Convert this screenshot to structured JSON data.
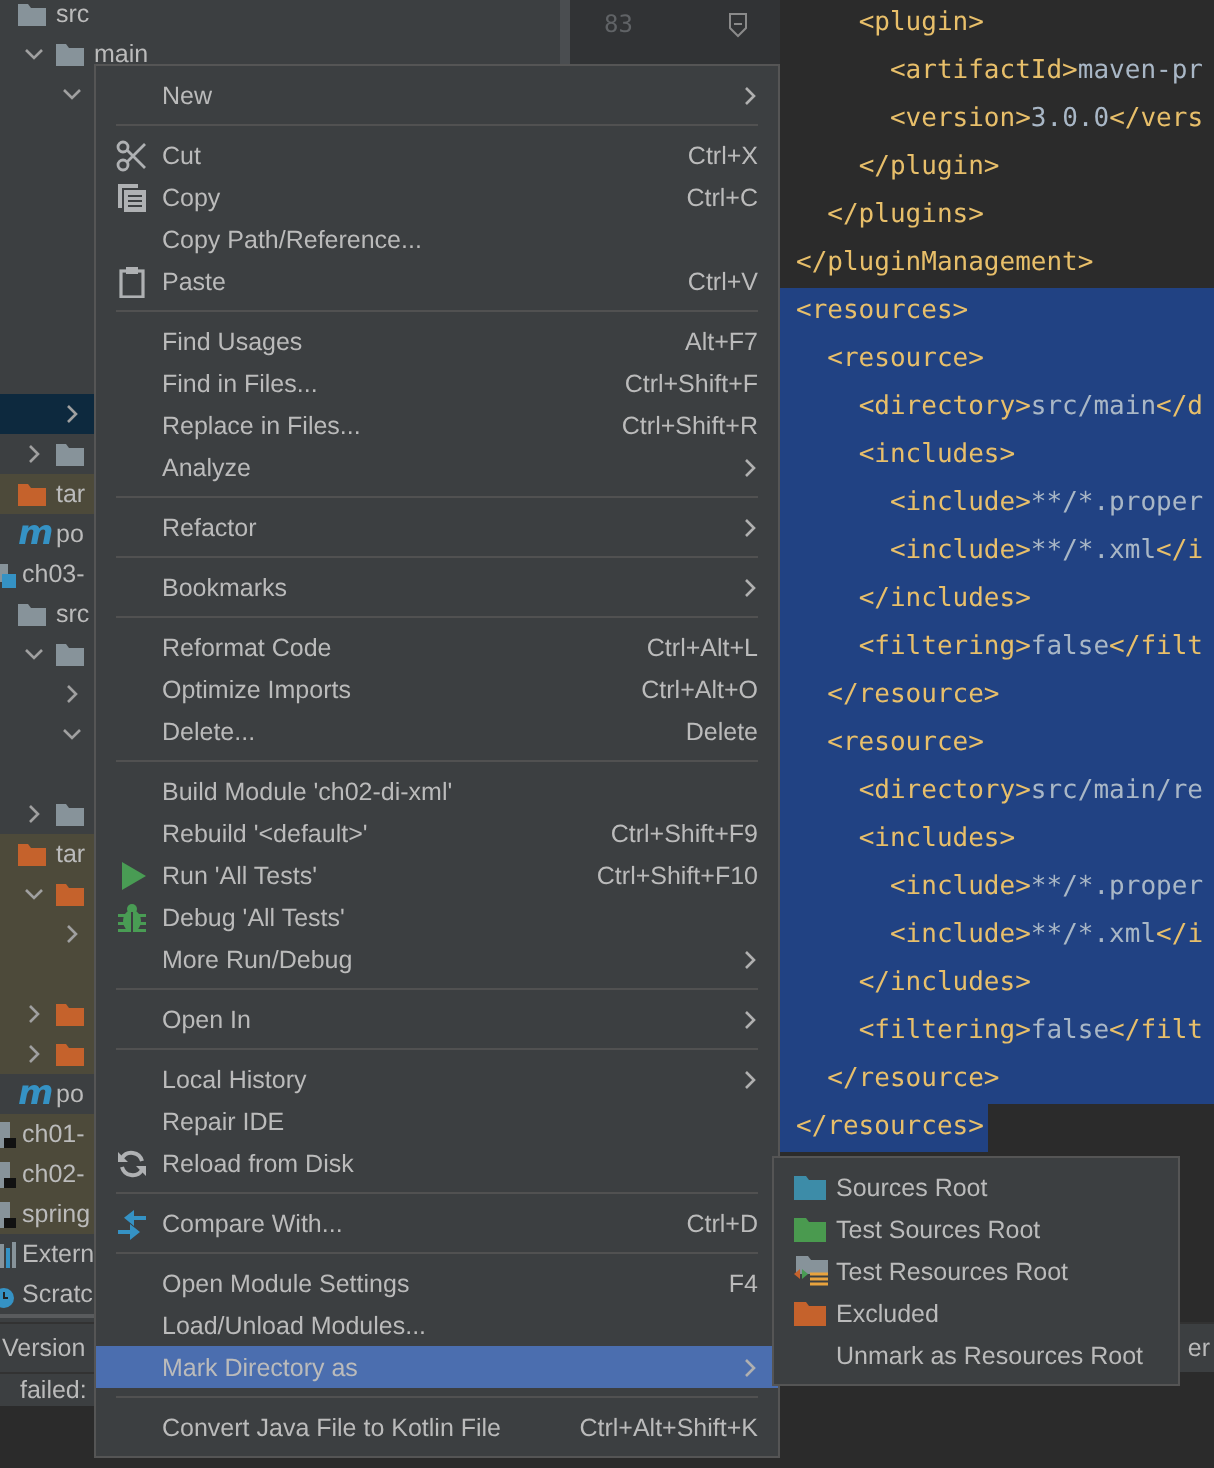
{
  "project_tree": {
    "scrolled_module": {
      "children": [
        {
          "label": "src",
          "kind": "folder",
          "color": "#87939a",
          "selected": false,
          "children": [
            {
              "label": "main",
              "kind": "folder",
              "color": "#87939a",
              "expanded": true,
              "selected": false,
              "children": [
                {
                  "expanded": true,
                  "selected": false,
                  "children": [
                    {
                      "selected": false
                    },
                    {
                      "selected": false
                    },
                    {
                      "selected": false
                    },
                    {
                      "selected": false
                    },
                    {
                      "selected": false
                    },
                    {
                      "selected": false
                    },
                    {
                      "selected": false
                    }
                  ]
                },
                {
                  "expanded": false,
                  "selected": true
                }
              ]
            },
            {
              "kind": "folder",
              "color": "#87939a",
              "expanded": false,
              "selected": false
            }
          ]
        },
        {
          "label": "tar",
          "kind": "folder",
          "color": "#c5622c",
          "selected": false,
          "tinted": true
        },
        {
          "label": "po",
          "kind": "maven",
          "badge": "m",
          "selected": false
        }
      ]
    },
    "items": [
      {
        "label": "ch03-",
        "kind": "module",
        "selected": false,
        "children": [
          {
            "label": "src",
            "kind": "folder",
            "color": "#87939a",
            "selected": false,
            "children": [
              {
                "kind": "folder",
                "color": "#87939a",
                "expanded": true,
                "selected": false,
                "children": [
                  {
                    "expanded": false,
                    "selected": false
                  },
                  {
                    "expanded": true,
                    "selected": false,
                    "children": [
                      {
                        "selected": false
                      }
                    ]
                  }
                ]
              },
              {
                "kind": "folder",
                "color": "#87939a",
                "expanded": false,
                "selected": false
              }
            ]
          },
          {
            "label": "tar",
            "kind": "folder",
            "color": "#c5622c",
            "selected": false,
            "tinted": true,
            "children": [
              {
                "kind": "folder",
                "color": "#c5622c",
                "expanded": true,
                "selected": false,
                "tinted": true,
                "children": [
                  {
                    "expanded": false,
                    "selected": false,
                    "tinted": true
                  },
                  {
                    "selected": false,
                    "tinted": true
                  }
                ]
              },
              {
                "kind": "folder",
                "color": "#c5622c",
                "expanded": false,
                "selected": false,
                "tinted": true
              },
              {
                "kind": "folder",
                "color": "#c5622c",
                "expanded": false,
                "selected": false,
                "tinted": true
              }
            ]
          },
          {
            "label": "po",
            "kind": "maven",
            "badge": "m",
            "selected": false
          }
        ]
      },
      {
        "label": "ch01-",
        "kind": "module-file",
        "selected": false,
        "tinted": true
      },
      {
        "label": "ch02-",
        "kind": "module-file",
        "selected": false,
        "tinted": true
      },
      {
        "label": "spring",
        "kind": "module-file",
        "selected": false,
        "tinted": true
      },
      {
        "label": "Extern",
        "kind": "library",
        "selected": false
      },
      {
        "label": "Scratc",
        "kind": "scratch",
        "selected": false
      }
    ]
  },
  "bottom_panel": {
    "tab": "Version",
    "message": "failed:",
    "right_tab": "er"
  },
  "editor": {
    "line_number": "83",
    "lines": [
      {
        "text": "    <plugin>",
        "selected": false
      },
      {
        "text": "      <artifactId>maven-pr",
        "selected": false
      },
      {
        "text": "      <version>3.0.0</vers",
        "selected": false
      },
      {
        "text": "    </plugin>",
        "selected": false
      },
      {
        "text": "  </plugins>",
        "selected": false
      },
      {
        "text": "</pluginManagement>",
        "selected": false
      },
      {
        "text": "<resources>",
        "selected": true
      },
      {
        "text": "  <resource>",
        "selected": true
      },
      {
        "text": "    <directory>src/main</d",
        "selected": true
      },
      {
        "text": "    <includes>",
        "selected": true
      },
      {
        "text": "      <include>**/*.proper",
        "selected": true
      },
      {
        "text": "      <include>**/*.xml</i",
        "selected": true
      },
      {
        "text": "    </includes>",
        "selected": true
      },
      {
        "text": "    <filtering>false</filt",
        "selected": true
      },
      {
        "text": "  </resource>",
        "selected": true
      },
      {
        "text": "  <resource>",
        "selected": true
      },
      {
        "text": "    <directory>src/main/re",
        "selected": true
      },
      {
        "text": "    <includes>",
        "selected": true
      },
      {
        "text": "      <include>**/*.proper",
        "selected": true
      },
      {
        "text": "      <include>**/*.xml</i",
        "selected": true
      },
      {
        "text": "    </includes>",
        "selected": true
      },
      {
        "text": "    <filtering>false</filt",
        "selected": true
      },
      {
        "text": "  </resource>",
        "selected": true
      },
      {
        "text": "</resources>",
        "selected": true
      }
    ]
  },
  "context_menu": {
    "groups": [
      [
        {
          "label": "New",
          "submenu": true,
          "selected": false
        }
      ],
      [
        {
          "label": "Cut",
          "kind": "scissors",
          "shortcut": "Ctrl+X",
          "selected": false
        },
        {
          "label": "Copy",
          "kind": "copy",
          "shortcut": "Ctrl+C",
          "selected": false
        },
        {
          "label": "Copy Path/Reference...",
          "selected": false
        },
        {
          "label": "Paste",
          "kind": "clipboard",
          "shortcut": "Ctrl+V",
          "selected": false
        }
      ],
      [
        {
          "label": "Find Usages",
          "shortcut": "Alt+F7",
          "selected": false
        },
        {
          "label": "Find in Files...",
          "shortcut": "Ctrl+Shift+F",
          "selected": false
        },
        {
          "label": "Replace in Files...",
          "shortcut": "Ctrl+Shift+R",
          "selected": false
        },
        {
          "label": "Analyze",
          "submenu": true,
          "selected": false
        }
      ],
      [
        {
          "label": "Refactor",
          "submenu": true,
          "selected": false
        }
      ],
      [
        {
          "label": "Bookmarks",
          "submenu": true,
          "selected": false
        }
      ],
      [
        {
          "label": "Reformat Code",
          "shortcut": "Ctrl+Alt+L",
          "selected": false
        },
        {
          "label": "Optimize Imports",
          "shortcut": "Ctrl+Alt+O",
          "selected": false
        },
        {
          "label": "Delete...",
          "shortcut": "Delete",
          "selected": false
        }
      ],
      [
        {
          "label": "Build Module 'ch02-di-xml'",
          "selected": false
        },
        {
          "label": "Rebuild '<default>'",
          "shortcut": "Ctrl+Shift+F9",
          "selected": false
        },
        {
          "label": "Run 'All Tests'",
          "kind": "play",
          "shortcut": "Ctrl+Shift+F10",
          "selected": false
        },
        {
          "label": "Debug 'All Tests'",
          "kind": "bug",
          "selected": false
        },
        {
          "label": "More Run/Debug",
          "submenu": true,
          "selected": false
        }
      ],
      [
        {
          "label": "Open In",
          "submenu": true,
          "selected": false
        }
      ],
      [
        {
          "label": "Local History",
          "submenu": true,
          "selected": false
        },
        {
          "label": "Repair IDE",
          "selected": false
        },
        {
          "label": "Reload from Disk",
          "kind": "reload",
          "selected": false
        }
      ],
      [
        {
          "label": "Compare With...",
          "kind": "compare",
          "shortcut": "Ctrl+D",
          "selected": false
        }
      ],
      [
        {
          "label": "Open Module Settings",
          "shortcut": "F4",
          "selected": false
        },
        {
          "label": "Load/Unload Modules...",
          "selected": false
        },
        {
          "label": "Mark Directory as",
          "submenu": true,
          "selected": true
        }
      ],
      [
        {
          "label": "Convert Java File to Kotlin File",
          "shortcut": "Ctrl+Alt+Shift+K",
          "selected": false
        }
      ]
    ]
  },
  "submenu": {
    "items": [
      {
        "label": "Sources Root",
        "kind": "folder",
        "color": "#3d8ca8",
        "selected": false
      },
      {
        "label": "Test Sources Root",
        "kind": "folder",
        "color": "#4a9a4f",
        "selected": false
      },
      {
        "label": "Test Resources Root",
        "kind": "resources-folder",
        "color": "#87939a",
        "selected": false
      },
      {
        "label": "Excluded",
        "kind": "folder",
        "color": "#c5622c",
        "selected": false
      },
      {
        "label": "Unmark as Resources Root",
        "selected": false
      }
    ]
  }
}
